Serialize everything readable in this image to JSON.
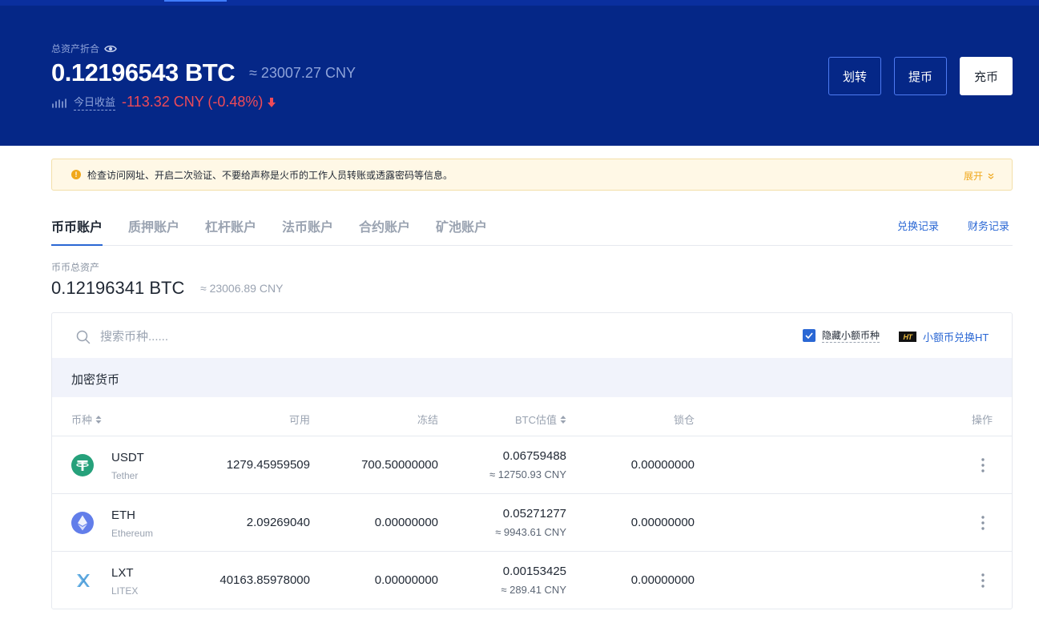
{
  "header": {
    "total_label": "总资产折合",
    "total_btc": "0.12196543 BTC",
    "total_cny": "≈ 23007.27 CNY",
    "income_label": "今日收益",
    "income_value": "-113.32 CNY (-0.48%)",
    "buttons": {
      "transfer": "划转",
      "withdraw": "提币",
      "deposit": "充币"
    }
  },
  "notice": {
    "text": "检查访问网址、开启二次验证、不要给声称是火币的工作人员转账或透露密码等信息。",
    "expand_label": "展开"
  },
  "tabs": {
    "items": [
      "币币账户",
      "质押账户",
      "杠杆账户",
      "法币账户",
      "合约账户",
      "矿池账户"
    ],
    "active": 0,
    "links": [
      "兑换记录",
      "财务记录"
    ]
  },
  "account": {
    "label": "币币总资产",
    "btc": "0.12196341 BTC",
    "cny": "≈ 23006.89 CNY"
  },
  "search": {
    "placeholder": "搜索币种......",
    "hide_small_label": "隐藏小额币种",
    "hide_small_checked": true,
    "convert_label": "小额币兑换HT",
    "ht_badge": "HT"
  },
  "table": {
    "section_title": "加密货币",
    "columns": [
      "币种",
      "可用",
      "冻结",
      "BTC估值",
      "锁仓",
      "操作"
    ],
    "rows": [
      {
        "symbol": "USDT",
        "name": "Tether",
        "available": "1279.45959509",
        "frozen": "700.50000000",
        "btc_value": "0.06759488",
        "cny_value": "≈ 12750.93 CNY",
        "locked": "0.00000000",
        "icon": "tether-icon"
      },
      {
        "symbol": "ETH",
        "name": "Ethereum",
        "available": "2.09269040",
        "frozen": "0.00000000",
        "btc_value": "0.05271277",
        "cny_value": "≈ 9943.61 CNY",
        "locked": "0.00000000",
        "icon": "ethereum-icon"
      },
      {
        "symbol": "LXT",
        "name": "LITEX",
        "available": "40163.85978000",
        "frozen": "0.00000000",
        "btc_value": "0.00153425",
        "cny_value": "≈ 289.41 CNY",
        "locked": "0.00000000",
        "icon": "litex-icon"
      }
    ]
  },
  "colors": {
    "header_bg": "#052787",
    "accent": "#2a67d4",
    "negative": "#ee4a58",
    "warning": "#f0a81c",
    "tether": "#26a17b",
    "ethereum": "#627eea"
  }
}
